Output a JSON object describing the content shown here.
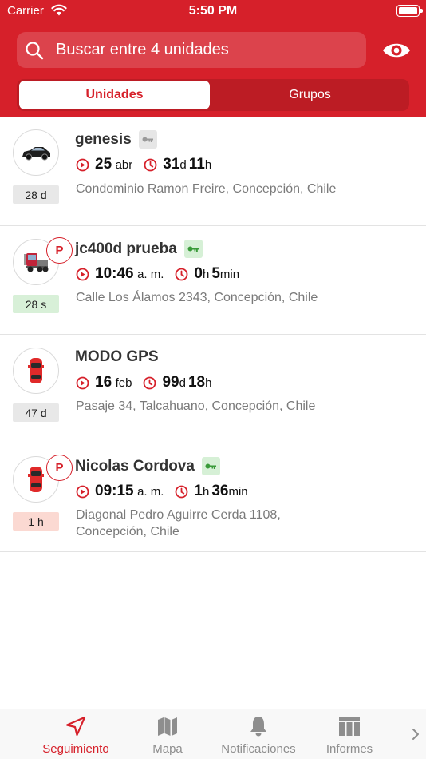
{
  "status_bar": {
    "carrier": "Carrier",
    "time": "5:50 PM"
  },
  "search": {
    "placeholder": "Buscar entre 4 unidades"
  },
  "segments": {
    "active": "Unidades",
    "inactive": "Grupos"
  },
  "units": [
    {
      "name": "genesis",
      "vehicle_icon": "black-car-icon",
      "parked": false,
      "key_status": "grey",
      "last_report": {
        "value": "25",
        "unit": "abr"
      },
      "duration": [
        {
          "value": "31",
          "unit": "d"
        },
        {
          "value": "11",
          "unit": "h"
        }
      ],
      "address": "Condominio Ramon Freire, Concepción, Chile",
      "ago": "28 d",
      "ago_color": "grey"
    },
    {
      "name": "jc400d prueba",
      "vehicle_icon": "truck-icon",
      "parked": true,
      "parked_label": "P",
      "key_status": "green",
      "last_report": {
        "value": "10:46",
        "unit": "a. m."
      },
      "duration": [
        {
          "value": "0",
          "unit": "h"
        },
        {
          "value": "5",
          "unit": "min"
        }
      ],
      "address": "Calle Los Álamos 2343, Concepción, Chile",
      "ago": "28 s",
      "ago_color": "green"
    },
    {
      "name": "MODO GPS",
      "vehicle_icon": "red-car-top-icon",
      "parked": false,
      "key_status": "none",
      "last_report": {
        "value": "16",
        "unit": "feb"
      },
      "duration": [
        {
          "value": "99",
          "unit": "d"
        },
        {
          "value": "18",
          "unit": "h"
        }
      ],
      "address": "Pasaje 34, Talcahuano, Concepción, Chile",
      "ago": "47 d",
      "ago_color": "grey"
    },
    {
      "name": "Nicolas Cordova",
      "vehicle_icon": "red-car-top-icon",
      "parked": true,
      "parked_label": "P",
      "key_status": "green",
      "last_report": {
        "value": "09:15",
        "unit": "a. m."
      },
      "duration": [
        {
          "value": "1",
          "unit": "h"
        },
        {
          "value": "36",
          "unit": "min"
        }
      ],
      "address_lines": [
        "Diagonal Pedro Aguirre Cerda 1108,",
        "Concepción, Chile"
      ],
      "ago": "1 h",
      "ago_color": "pink"
    }
  ],
  "tabbar": {
    "tabs": [
      {
        "label": "Seguimiento",
        "icon": "navigation-arrow-icon",
        "active": true
      },
      {
        "label": "Mapa",
        "icon": "map-icon",
        "active": false
      },
      {
        "label": "Notificaciones",
        "icon": "bell-icon",
        "active": false
      },
      {
        "label": "Informes",
        "icon": "report-table-icon",
        "active": false
      }
    ]
  },
  "colors": {
    "brand_red": "#d6202a",
    "key_grey": "#9a9a9a",
    "key_green": "#3a9a3a"
  }
}
